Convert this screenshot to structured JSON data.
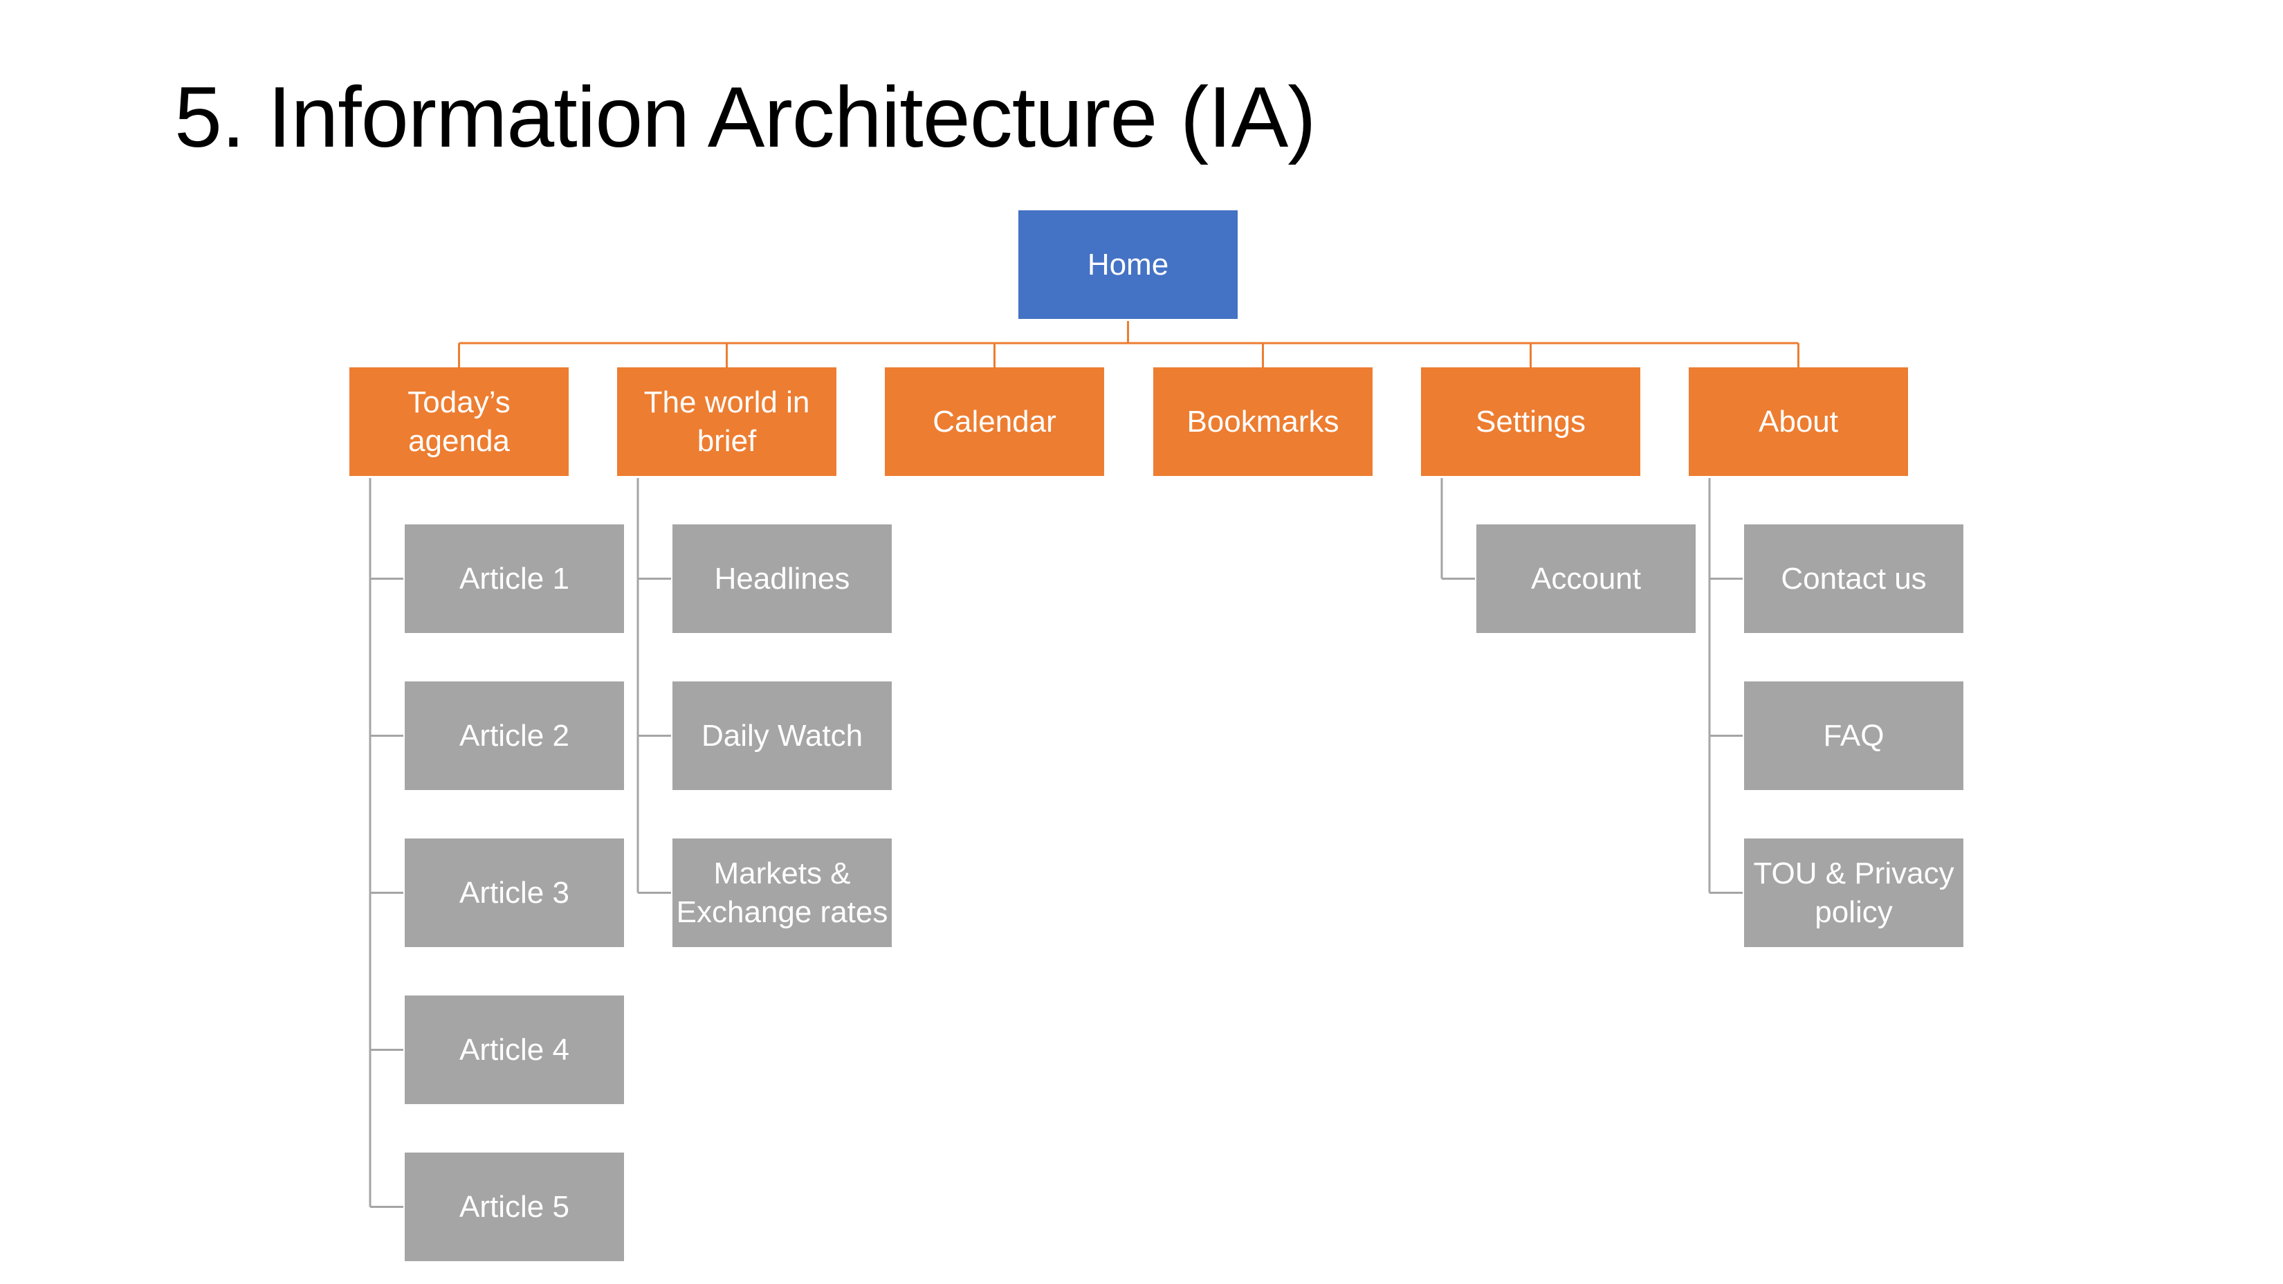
{
  "slide": {
    "title": "5. Information Architecture (IA)"
  },
  "colors": {
    "root": "#4472C4",
    "level1": "#ED7D31",
    "level2": "#A5A5A5",
    "level1_connector": "#ED7D31",
    "level2_connector": "#A5A5A5"
  },
  "tree": {
    "root": {
      "label": "Home"
    },
    "sections": [
      {
        "label": "Today’s\nagenda",
        "children": [
          "Article 1",
          "Article 2",
          "Article 3",
          "Article 4",
          "Article 5"
        ]
      },
      {
        "label": "The world in\nbrief",
        "children": [
          "Headlines",
          "Daily Watch",
          "Markets &\nExchange rates"
        ]
      },
      {
        "label": "Calendar",
        "children": []
      },
      {
        "label": "Bookmarks",
        "children": []
      },
      {
        "label": "Settings",
        "children": [
          "Account"
        ]
      },
      {
        "label": "About",
        "children": [
          "Contact us",
          "FAQ",
          "TOU & Privacy\npolicy"
        ]
      }
    ]
  }
}
